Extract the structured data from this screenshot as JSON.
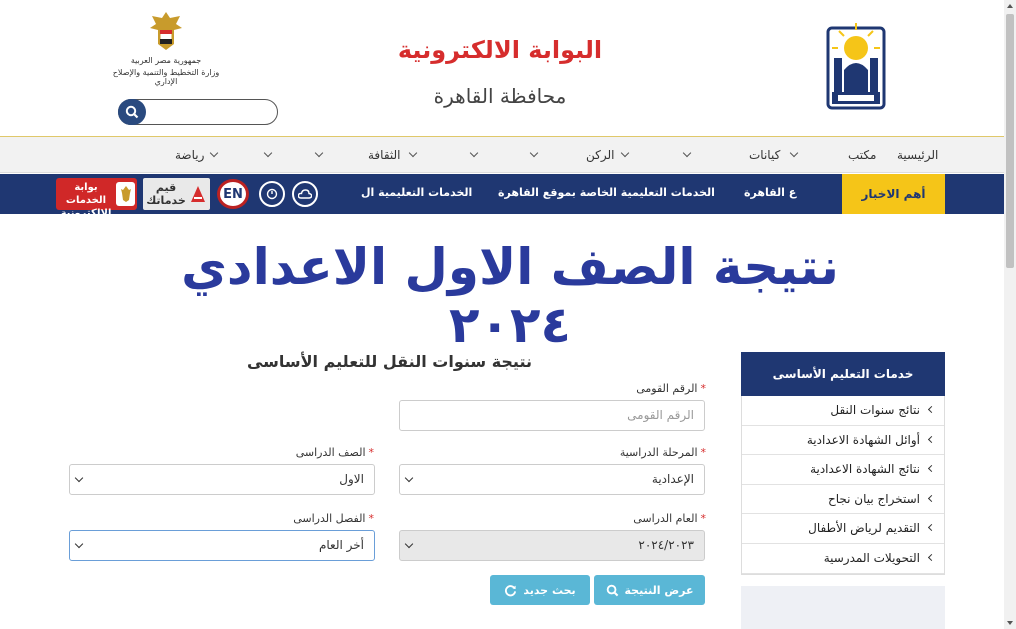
{
  "header": {
    "portal_title": "البوابة الالكترونية",
    "governorate": "محافظة القاهرة",
    "egypt_line1": "جمهورية مصر العربية",
    "egypt_line2": "وزارة التخطيط والتنمية والإصلاح الإداري",
    "search_placeholder": ""
  },
  "nav": {
    "items": [
      "الرئيسية",
      "مكتب",
      "كيانات",
      "",
      "الركن",
      "",
      "الثقافة",
      "",
      "",
      "رياضة"
    ]
  },
  "newsbar": {
    "label": "أهم الاخبار",
    "ticker1": "ع القاهرة",
    "ticker2": "الخدمات التعليمية الخاصة بموقع القاهرة",
    "ticker3": "الخدمات التعليمية ال",
    "en": "EN",
    "khadamatak": "قيم خدماتك",
    "eservices": "بوابة الخدمات الإلكترونية"
  },
  "page_title": "نتيجة الصف الاول الاعدادي ٢٠٢٤",
  "sidebar": {
    "title": "خدمات التعليم الأساسى",
    "items": [
      "نتائج سنوات النقل",
      "أوائل الشهادة الاعدادية",
      "نتائج الشهادة الاعدادية",
      "استخراج بيان نجاح",
      "التقديم لرياض الأطفال",
      "التحويلات المدرسية"
    ]
  },
  "form": {
    "title": "نتيجة سنوات النقل للتعليم الأساسى",
    "national_id_label": "الرقم القومى",
    "national_id_placeholder": "الرقم القومى",
    "stage_label": "المرحلة الدراسية",
    "stage_value": "الإعدادية",
    "grade_label": "الصف الدراسى",
    "grade_value": "الاول",
    "year_label": "العام الدراسى",
    "year_value": "٢٠٢٤/٢٠٢٣",
    "term_label": "الفصل الدراسى",
    "term_value": "أخر العام",
    "show_result": "عرض النتيجة",
    "new_search": "بحث جديد"
  },
  "colors": {
    "navy": "#1f3772",
    "accent_red": "#d62d2d",
    "news_yellow": "#f5c518",
    "button_blue": "#5ab7d6",
    "title_blue": "#2a3a9c"
  }
}
